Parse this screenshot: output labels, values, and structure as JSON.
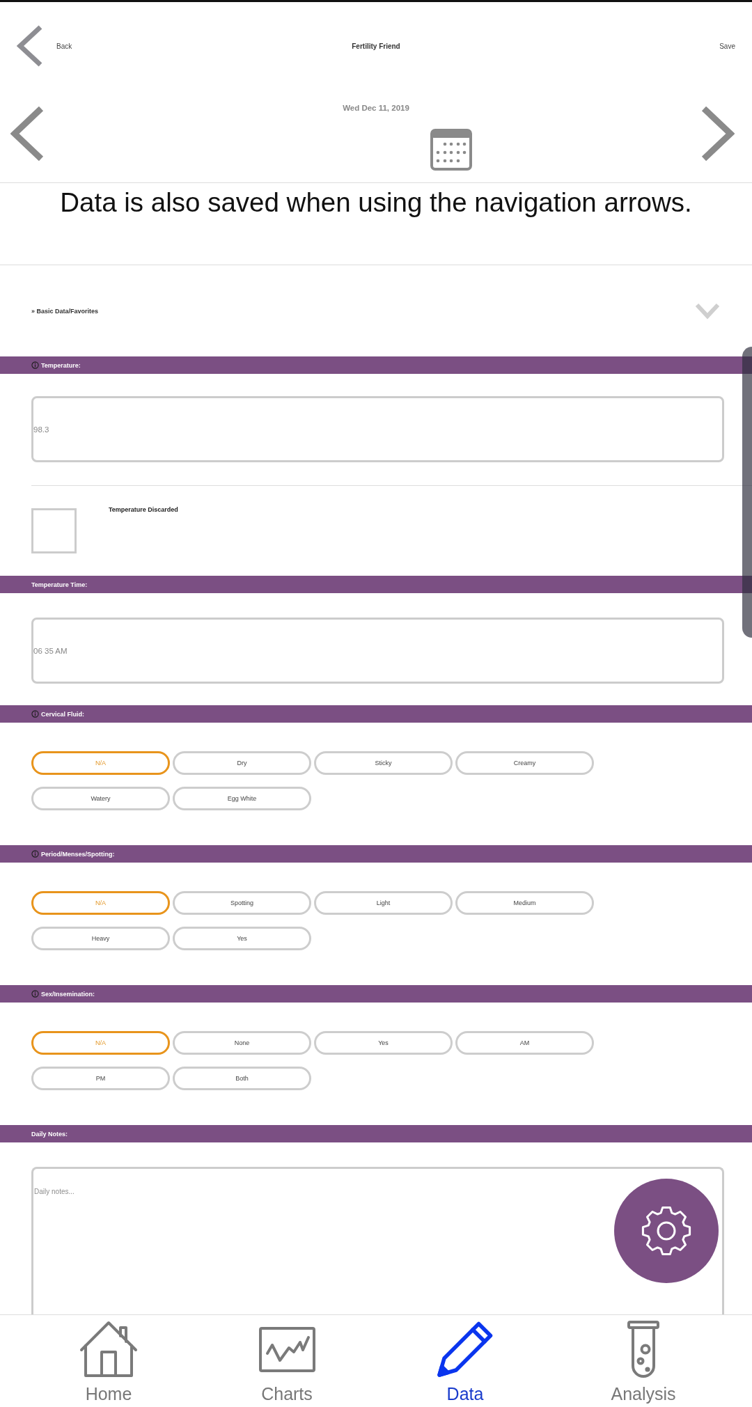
{
  "header": {
    "back": "Back",
    "title": "Fertility Friend",
    "save": "Save"
  },
  "date_nav": {
    "date": "Wed Dec 11, 2019"
  },
  "notice": "Data is also saved when using the navigation arrows.",
  "section": {
    "title": "» Basic Data/Favorites"
  },
  "fields": [
    {
      "kind": "input",
      "label": "Temperature:",
      "info": true,
      "value": "98.3",
      "checkbox": {
        "label": "Temperature Discarded",
        "checked": false
      }
    },
    {
      "kind": "input",
      "label": "Temperature Time:",
      "info": false,
      "value": "06 35 AM"
    },
    {
      "kind": "choices",
      "label": "Cervical Fluid:",
      "info": true,
      "options": [
        {
          "label": "N/A",
          "selected": true
        },
        {
          "label": "Dry",
          "selected": false
        },
        {
          "label": "Sticky",
          "selected": false
        },
        {
          "label": "Creamy",
          "selected": false
        },
        {
          "label": "Watery",
          "selected": false
        },
        {
          "label": "Egg White",
          "selected": false
        }
      ]
    },
    {
      "kind": "choices",
      "label": "Period/Menses/Spotting:",
      "info": true,
      "options": [
        {
          "label": "N/A",
          "selected": true
        },
        {
          "label": "Spotting",
          "selected": false
        },
        {
          "label": "Light",
          "selected": false
        },
        {
          "label": "Medium",
          "selected": false
        },
        {
          "label": "Heavy",
          "selected": false
        },
        {
          "label": "Yes",
          "selected": false
        }
      ]
    },
    {
      "kind": "choices",
      "label": "Sex/Insemination:",
      "info": true,
      "options": [
        {
          "label": "N/A",
          "selected": true
        },
        {
          "label": "None",
          "selected": false
        },
        {
          "label": "Yes",
          "selected": false
        },
        {
          "label": "AM",
          "selected": false
        },
        {
          "label": "PM",
          "selected": false
        },
        {
          "label": "Both",
          "selected": false
        }
      ]
    },
    {
      "kind": "notes",
      "label": "Daily Notes:",
      "info": false,
      "placeholder": "Daily notes..."
    }
  ],
  "nav": [
    {
      "kind": "home",
      "label": "Home",
      "selected": false
    },
    {
      "kind": "charts",
      "label": "Charts",
      "selected": false
    },
    {
      "kind": "data",
      "label": "Data",
      "selected": true
    },
    {
      "kind": "analysis",
      "label": "Analysis",
      "selected": false
    }
  ]
}
